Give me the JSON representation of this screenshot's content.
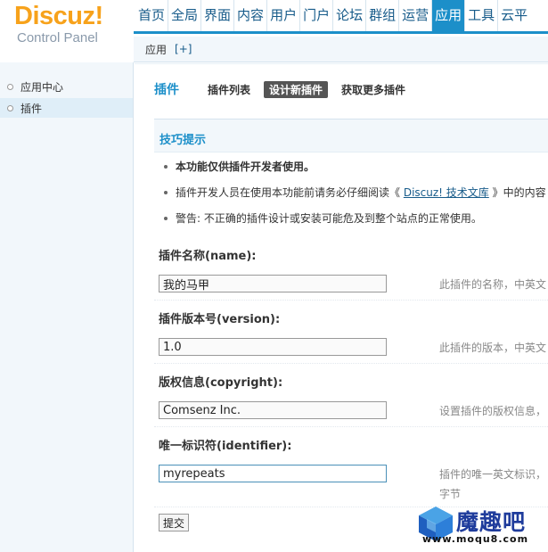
{
  "logo": {
    "text": "Discuz!",
    "subtitle": "Control Panel"
  },
  "topnav": {
    "items": [
      {
        "label": "首页"
      },
      {
        "label": "全局"
      },
      {
        "label": "界面"
      },
      {
        "label": "内容"
      },
      {
        "label": "用户"
      },
      {
        "label": "门户"
      },
      {
        "label": "论坛"
      },
      {
        "label": "群组"
      },
      {
        "label": "运营"
      },
      {
        "label": "应用",
        "active": true
      },
      {
        "label": "工具"
      },
      {
        "label": "云平"
      }
    ]
  },
  "subbar": {
    "label": "应用",
    "plus": "[+]"
  },
  "sidebar": {
    "items": [
      {
        "label": "应用中心"
      },
      {
        "label": "插件",
        "active": true
      }
    ]
  },
  "page": {
    "title": "插件",
    "tabs": [
      {
        "label": "插件列表"
      },
      {
        "label": "设计新插件",
        "current": true
      },
      {
        "label": "获取更多插件"
      }
    ]
  },
  "tips": {
    "title": "技巧提示",
    "items": [
      {
        "text": "本功能仅供插件开发者使用。"
      },
      {
        "before": "插件开发人员在使用本功能前请务必仔细阅读《 ",
        "link": "Discuz! 技术文库",
        "after": " 》中的内容"
      },
      {
        "text": "警告: 不正确的插件设计或安装可能危及到整个站点的正常使用。"
      }
    ]
  },
  "form": {
    "fields": [
      {
        "label": "插件名称(name):",
        "value": "我的马甲",
        "hint": "此插件的名称，中英文"
      },
      {
        "label": "插件版本号(version):",
        "value": "1.0",
        "hint": "此插件的版本，中英文"
      },
      {
        "label": "版权信息(copyright):",
        "value": "Comsenz Inc.",
        "hint": "设置插件的版权信息，"
      },
      {
        "label": "唯一标识符(identifier):",
        "value": "myrepeats",
        "hint": "插件的唯一英文标识，",
        "hint2": "字节"
      }
    ],
    "submit_label": "提交"
  },
  "watermark": {
    "text": "魔趣吧",
    "url": "www.moqu8.com"
  },
  "colors": {
    "accent": "#1c8fc9",
    "logo": "#f7a21b",
    "sidebar_bg": "#f2f7fb"
  }
}
